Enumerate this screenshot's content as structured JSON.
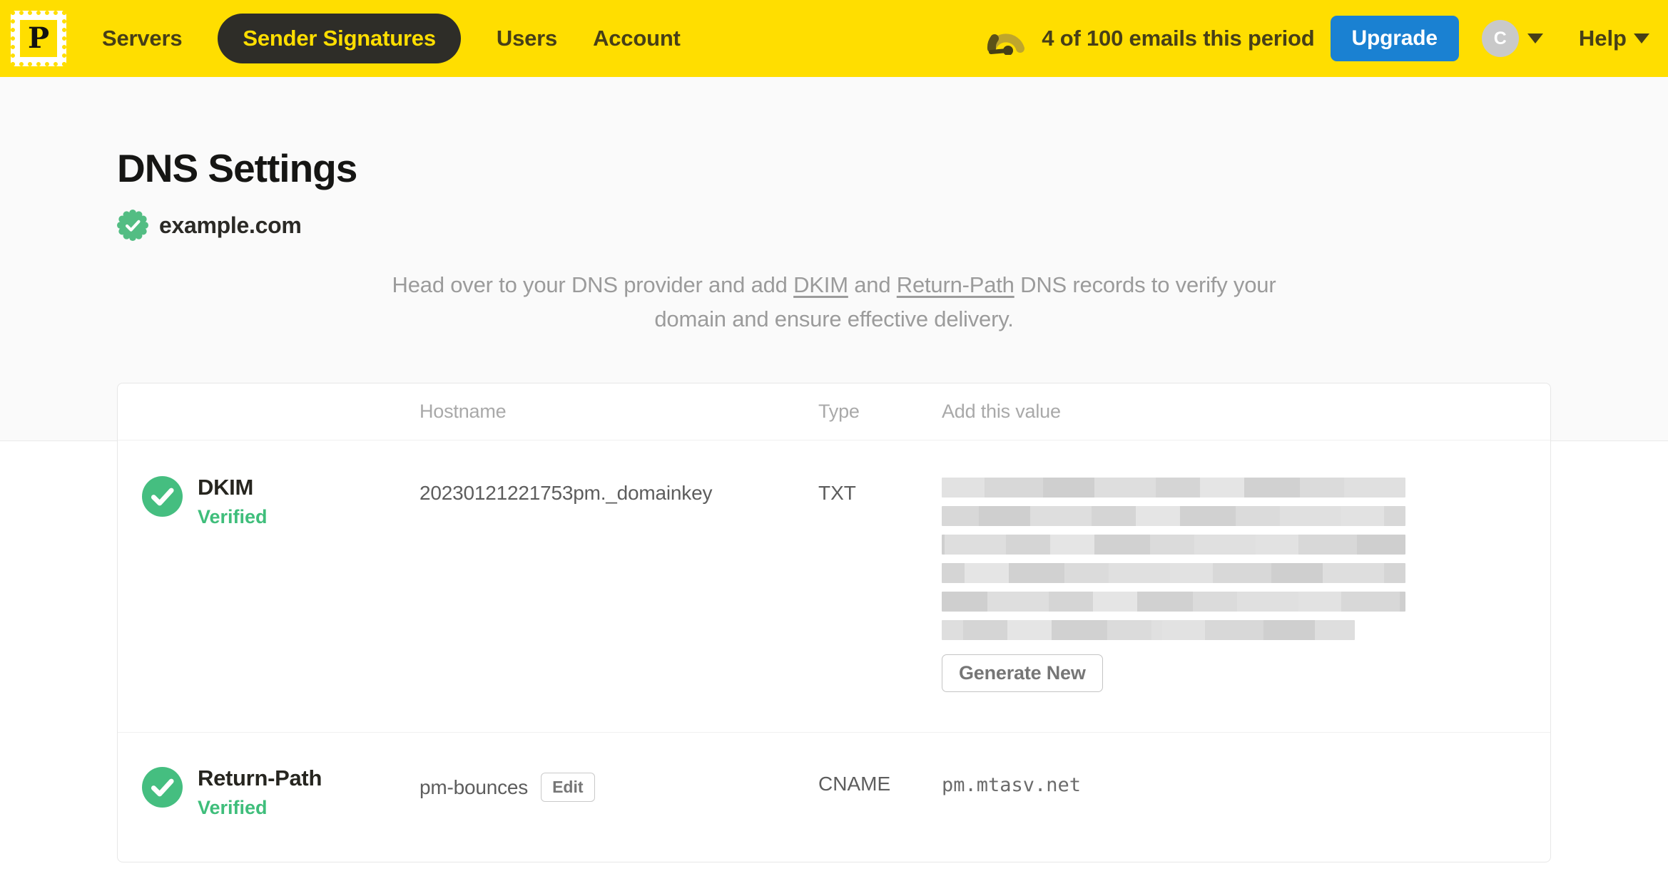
{
  "nav": {
    "logo_letter": "P",
    "items": [
      {
        "label": "Servers",
        "active": false
      },
      {
        "label": "Sender Signatures",
        "active": true
      },
      {
        "label": "Users",
        "active": false
      },
      {
        "label": "Account",
        "active": false
      }
    ],
    "usage_text": "4 of 100 emails this period",
    "upgrade_label": "Upgrade",
    "avatar_letter": "C",
    "help_label": "Help"
  },
  "page": {
    "title": "DNS Settings",
    "domain": "example.com",
    "description": {
      "intro": "Head over to your DNS provider and add ",
      "link1": "DKIM",
      "mid": " and ",
      "link2": "Return-Path",
      "tail": " DNS records to verify your domain and ensure effective delivery."
    }
  },
  "table": {
    "headers": {
      "hostname": "Hostname",
      "type": "Type",
      "value": "Add this value"
    },
    "rows": [
      {
        "name": "DKIM",
        "status": "Verified",
        "hostname": "20230121221753pm._domainkey",
        "type": "TXT",
        "value_redacted": true,
        "action_label": "Generate New"
      },
      {
        "name": "Return-Path",
        "status": "Verified",
        "hostname": "pm-bounces",
        "edit_label": "Edit",
        "type": "CNAME",
        "value": "pm.mtasv.net"
      }
    ]
  },
  "icons": {
    "logo": "postmark-stamp-logo",
    "usage": "gauge-icon",
    "status": "check-circle-icon",
    "domain_badge": "seal-check-icon",
    "dropdown": "caret-down-icon"
  },
  "colors": {
    "brand_yellow": "#FFDE00",
    "nav_text": "#473F17",
    "active_pill_bg": "#2E2D28",
    "upgrade_blue": "#1A81D2",
    "verified_green": "#3FBE7B",
    "check_circle_green": "#45BE80",
    "muted_text": "#9B9B9B"
  }
}
